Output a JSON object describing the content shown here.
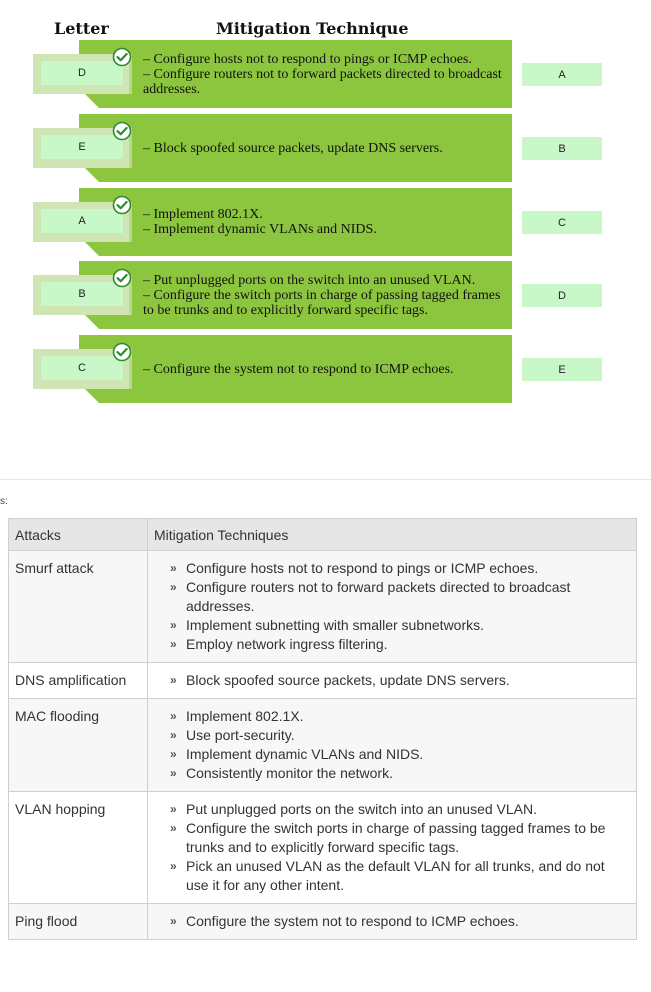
{
  "headers": {
    "letter": "Letter",
    "technique": "Mitigation Technique"
  },
  "rows": [
    {
      "letter": "D",
      "answer": "A",
      "lines": [
        "– Configure hosts not to respond to pings or ICMP echoes.",
        "– Configure routers not to forward packets directed to broadcast addresses."
      ]
    },
    {
      "letter": "E",
      "answer": "B",
      "lines": [
        "– Block spoofed source packets, update DNS servers."
      ]
    },
    {
      "letter": "A",
      "answer": "C",
      "lines": [
        "– Implement 802.1X.",
        "– Implement dynamic VLANs and NIDS."
      ]
    },
    {
      "letter": "B",
      "answer": "D",
      "lines": [
        "– Put unplugged ports on the switch into an unused VLAN.",
        "– Configure the switch ports in charge of passing tagged frames to be trunks and to explicitly forward specific tags."
      ]
    },
    {
      "letter": "C",
      "answer": "E",
      "lines": [
        "– Configure the system not to respond to ICMP echoes."
      ]
    }
  ],
  "explanation_marker": "s:",
  "table": {
    "headers": [
      "Attacks",
      "Mitigation Techniques"
    ],
    "rows": [
      {
        "attack": "Smurf attack",
        "items": [
          "Configure hosts not to respond to pings or ICMP echoes.",
          "Configure routers not to forward packets directed to broadcast addresses.",
          "Implement subnetting with smaller subnetworks.",
          "Employ network ingress filtering."
        ]
      },
      {
        "attack": "DNS amplification",
        "items": [
          "Block spoofed source packets, update DNS servers."
        ]
      },
      {
        "attack": "MAC flooding",
        "items": [
          "Implement 802.1X.",
          "Use port-security.",
          "Implement dynamic VLANs and NIDS.",
          "Consistently monitor the network."
        ]
      },
      {
        "attack": "VLAN hopping",
        "items": [
          "Put unplugged ports on the switch into an unused VLAN.",
          "Configure the switch ports in charge of passing tagged frames to be trunks and to explicitly forward specific tags.",
          "Pick an unused VLAN as the default VLAN for all trunks, and do not use it for any other intent."
        ]
      },
      {
        "attack": "Ping flood",
        "items": [
          "Configure the system not to respond to ICMP echoes."
        ]
      }
    ]
  },
  "colors": {
    "accent_green": "#8cc63f",
    "answer_green": "#c8f7c8",
    "check_green": "#2e8b2e"
  },
  "icons": {
    "check": "check-circle-icon",
    "bullet": "double-chevron-right-icon"
  }
}
